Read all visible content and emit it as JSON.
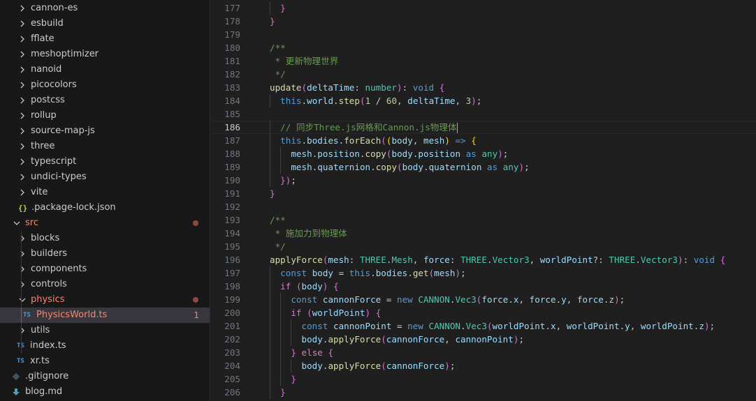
{
  "sidebar": {
    "items": [
      {
        "label": "cannon-es",
        "kind": "folder",
        "open": false
      },
      {
        "label": "esbuild",
        "kind": "folder",
        "open": false
      },
      {
        "label": "fflate",
        "kind": "folder",
        "open": false
      },
      {
        "label": "meshoptimizer",
        "kind": "folder",
        "open": false
      },
      {
        "label": "nanoid",
        "kind": "folder",
        "open": false
      },
      {
        "label": "picocolors",
        "kind": "folder",
        "open": false
      },
      {
        "label": "postcss",
        "kind": "folder",
        "open": false
      },
      {
        "label": "rollup",
        "kind": "folder",
        "open": false
      },
      {
        "label": "source-map-js",
        "kind": "folder",
        "open": false
      },
      {
        "label": "three",
        "kind": "folder",
        "open": false
      },
      {
        "label": "typescript",
        "kind": "folder",
        "open": false
      },
      {
        "label": "undici-types",
        "kind": "folder",
        "open": false
      },
      {
        "label": "vite",
        "kind": "folder",
        "open": false
      },
      {
        "label": ".package-lock.json",
        "kind": "json",
        "icon_text": "{}"
      },
      {
        "label": "src",
        "kind": "folder",
        "open": true,
        "problem": true
      },
      {
        "label": "blocks",
        "kind": "folder",
        "open": false
      },
      {
        "label": "builders",
        "kind": "folder",
        "open": false
      },
      {
        "label": "components",
        "kind": "folder",
        "open": false
      },
      {
        "label": "controls",
        "kind": "folder",
        "open": false
      },
      {
        "label": "physics",
        "kind": "folder",
        "open": true,
        "problem": true
      },
      {
        "label": "PhysicsWorld.ts",
        "kind": "ts",
        "icon_text": "TS",
        "problem": true,
        "count": "1",
        "selected": true
      },
      {
        "label": "utils",
        "kind": "folder",
        "open": false
      },
      {
        "label": "index.ts",
        "kind": "ts",
        "icon_text": "TS"
      },
      {
        "label": "xr.ts",
        "kind": "ts",
        "icon_text": "TS"
      },
      {
        "label": ".gitignore",
        "kind": "git"
      },
      {
        "label": "blog.md",
        "kind": "md"
      }
    ]
  },
  "editor": {
    "current_line": "186",
    "lines": [
      {
        "n": "177",
        "code": "    }"
      },
      {
        "n": "178",
        "code": "  }"
      },
      {
        "n": "179",
        "code": ""
      },
      {
        "n": "180",
        "code": "  /**"
      },
      {
        "n": "181",
        "code": "   * 更新物理世界"
      },
      {
        "n": "182",
        "code": "   */"
      },
      {
        "n": "183",
        "code": "  update(deltaTime: number): void {"
      },
      {
        "n": "184",
        "code": "    this.world.step(1 / 60, deltaTime, 3);"
      },
      {
        "n": "185",
        "code": ""
      },
      {
        "n": "186",
        "code": "    // 同步Three.js网格和Cannon.js物理体"
      },
      {
        "n": "187",
        "code": "    this.bodies.forEach((body, mesh) => {"
      },
      {
        "n": "188",
        "code": "      mesh.position.copy(body.position as any);"
      },
      {
        "n": "189",
        "code": "      mesh.quaternion.copy(body.quaternion as any);"
      },
      {
        "n": "190",
        "code": "    });"
      },
      {
        "n": "191",
        "code": "  }"
      },
      {
        "n": "192",
        "code": ""
      },
      {
        "n": "193",
        "code": "  /**"
      },
      {
        "n": "194",
        "code": "   * 施加力到物理体"
      },
      {
        "n": "195",
        "code": "   */"
      },
      {
        "n": "196",
        "code": "  applyForce(mesh: THREE.Mesh, force: THREE.Vector3, worldPoint?: THREE.Vector3): void {"
      },
      {
        "n": "197",
        "code": "    const body = this.bodies.get(mesh);"
      },
      {
        "n": "198",
        "code": "    if (body) {"
      },
      {
        "n": "199",
        "code": "      const cannonForce = new CANNON.Vec3(force.x, force.y, force.z);"
      },
      {
        "n": "200",
        "code": "      if (worldPoint) {"
      },
      {
        "n": "201",
        "code": "        const cannonPoint = new CANNON.Vec3(worldPoint.x, worldPoint.y, worldPoint.z);"
      },
      {
        "n": "202",
        "code": "        body.applyForce(cannonForce, cannonPoint);"
      },
      {
        "n": "203",
        "code": "      } else {"
      },
      {
        "n": "204",
        "code": "        body.applyForce(cannonForce);"
      },
      {
        "n": "205",
        "code": "      }"
      },
      {
        "n": "206",
        "code": "    }"
      }
    ]
  },
  "colors": {
    "sidebar_bg": "#181818",
    "editor_bg": "#1f1f1f",
    "error": "#f48771",
    "selected_row": "#37373d"
  }
}
